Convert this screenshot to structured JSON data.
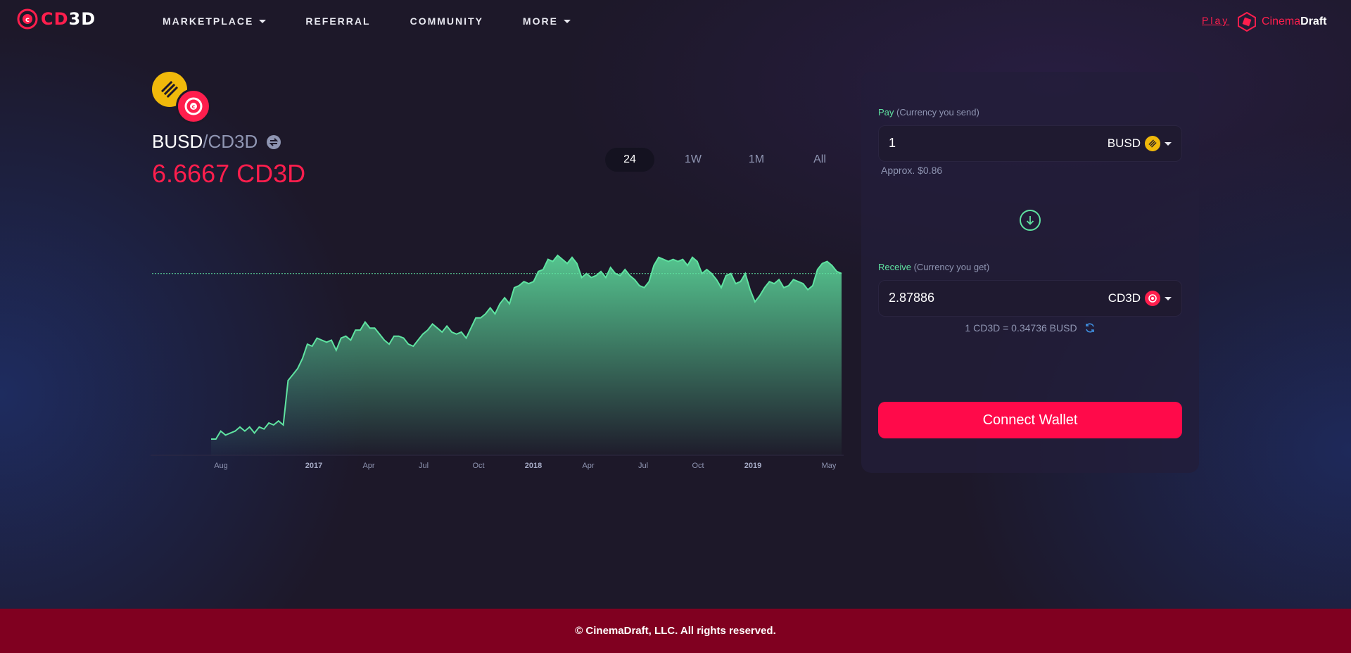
{
  "brand": {
    "logo_text": "CD3D",
    "logo_accent": "#ff1e4d"
  },
  "nav": {
    "items": [
      {
        "label": "MARKETPLACE",
        "has_dropdown": true
      },
      {
        "label": "REFERRAL",
        "has_dropdown": false
      },
      {
        "label": "COMMUNITY",
        "has_dropdown": false
      },
      {
        "label": "MORE",
        "has_dropdown": true
      }
    ],
    "play_label": "Play",
    "partner_brand": {
      "part1": "Cinema",
      "part2": "Draft"
    }
  },
  "pair": {
    "base": "BUSD",
    "separator": "/",
    "quote": "CD3D",
    "price": "6.6667 CD3D",
    "base_icon": "busd-coin-icon",
    "quote_icon": "cd3d-coin-icon"
  },
  "range_tabs": [
    {
      "label": "24",
      "active": true
    },
    {
      "label": "1W",
      "active": false
    },
    {
      "label": "1M",
      "active": false
    },
    {
      "label": "All",
      "active": false
    }
  ],
  "chart_data": {
    "type": "area",
    "x_tick_labels": [
      "Aug",
      "2017",
      "Apr",
      "Jul",
      "Oct",
      "2018",
      "Apr",
      "Jul",
      "Oct",
      "2019",
      "May"
    ],
    "year_ticks": [
      "2017",
      "2018",
      "2019"
    ],
    "reference_line": "dotted horizontal line at current value",
    "series": [
      {
        "color": "#5fe3a1",
        "values": [
          0.08,
          0.08,
          0.12,
          0.1,
          0.11,
          0.12,
          0.14,
          0.12,
          0.14,
          0.11,
          0.14,
          0.13,
          0.16,
          0.15,
          0.17,
          0.15,
          0.37,
          0.4,
          0.43,
          0.48,
          0.55,
          0.54,
          0.58,
          0.57,
          0.56,
          0.57,
          0.52,
          0.58,
          0.59,
          0.57,
          0.62,
          0.62,
          0.66,
          0.63,
          0.63,
          0.6,
          0.57,
          0.55,
          0.59,
          0.59,
          0.58,
          0.55,
          0.54,
          0.57,
          0.6,
          0.62,
          0.65,
          0.63,
          0.61,
          0.64,
          0.61,
          0.6,
          0.61,
          0.58,
          0.63,
          0.68,
          0.68,
          0.7,
          0.73,
          0.7,
          0.75,
          0.78,
          0.75,
          0.83,
          0.84,
          0.86,
          0.85,
          0.86,
          0.91,
          0.92,
          0.97,
          0.96,
          0.99,
          0.97,
          0.95,
          0.98,
          0.95,
          0.88,
          0.9,
          0.88,
          0.89,
          0.91,
          0.88,
          0.93,
          0.9,
          0.89,
          0.92,
          0.89,
          0.87,
          0.84,
          0.83,
          0.86,
          0.94,
          0.98,
          0.97,
          0.96,
          0.97,
          0.96,
          0.97,
          0.94,
          0.98,
          0.96,
          0.9,
          0.92,
          0.9,
          0.87,
          0.83,
          0.89,
          0.9,
          0.85,
          0.86,
          0.9,
          0.82,
          0.76,
          0.79,
          0.83,
          0.86,
          0.85,
          0.87,
          0.83,
          0.84,
          0.87,
          0.86,
          0.85,
          0.82,
          0.84,
          0.92,
          0.95,
          0.96,
          0.94,
          0.91,
          0.9
        ],
        "last_value": 0.9
      }
    ]
  },
  "swap": {
    "pay_label": "Pay",
    "pay_hint": "(Currency you send)",
    "pay_value": "1",
    "pay_token": "BUSD",
    "approx": "Approx. $0.86",
    "receive_label": "Receive",
    "receive_hint": "(Currency you get)",
    "receive_value": "2.87886",
    "receive_token": "CD3D",
    "rate": "1 CD3D = 0.34736 BUSD",
    "connect_label": "Connect Wallet"
  },
  "footer": {
    "text": "© CinemaDraft, LLC. All rights reserved."
  },
  "colors": {
    "accent": "#ff1e4d",
    "chart_line": "#5fe3a1",
    "footer_bg": "#800020",
    "button": "#ff0a4a"
  }
}
